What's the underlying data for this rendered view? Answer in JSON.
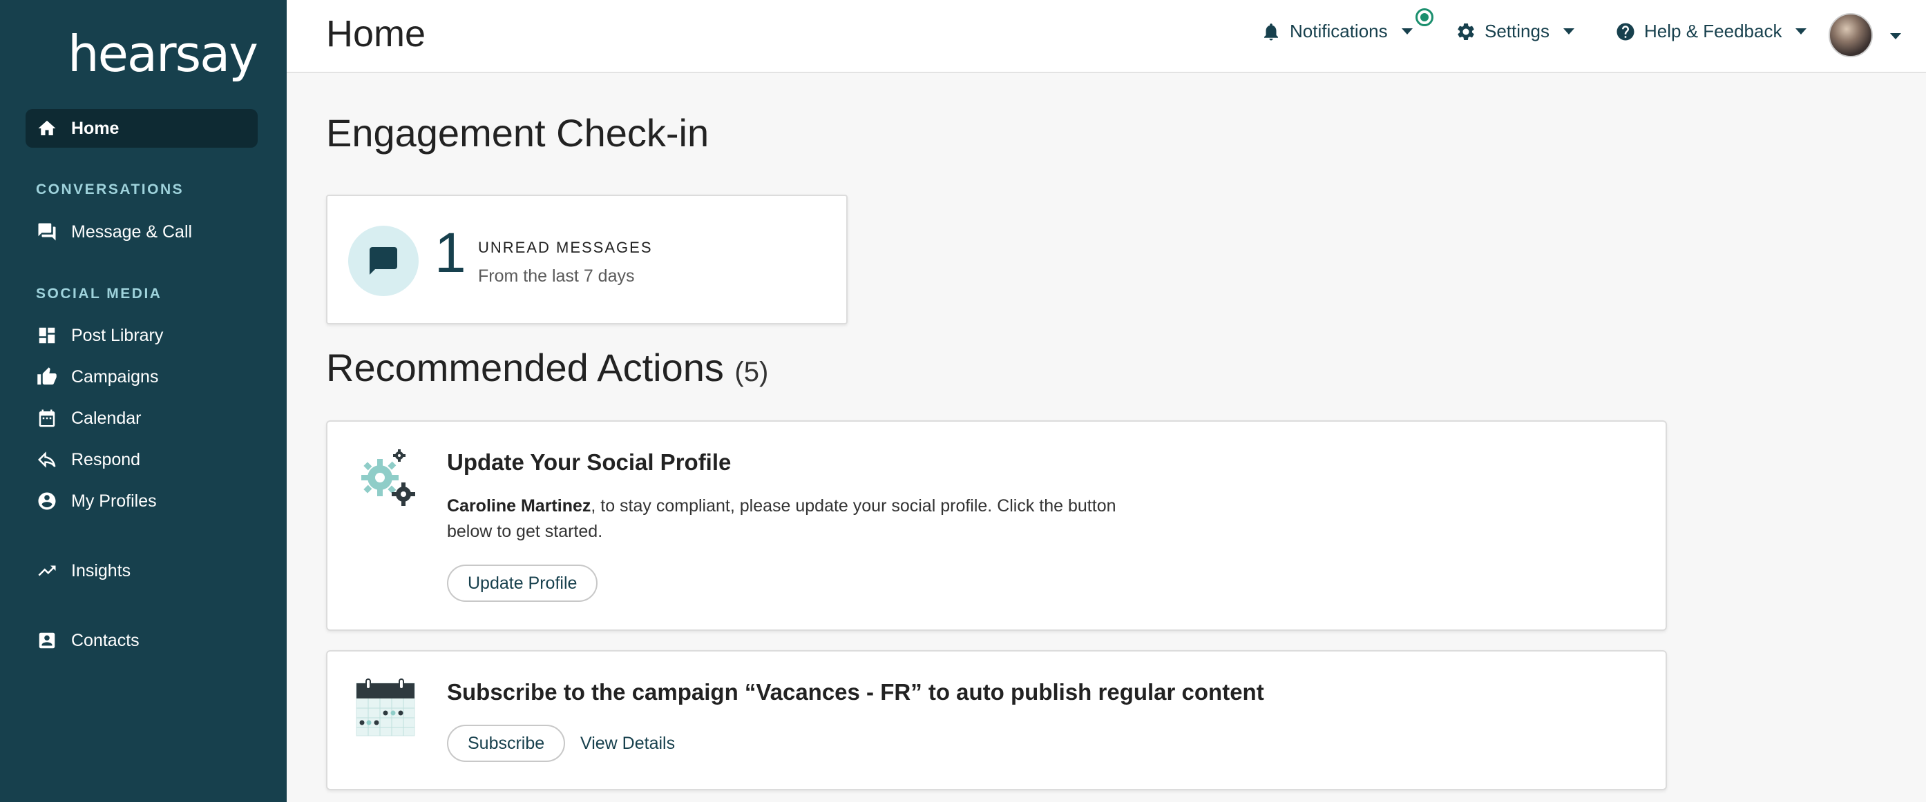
{
  "brand": {
    "logo_text": "hearsay"
  },
  "sidebar": {
    "home": "Home",
    "section_conversations": "CONVERSATIONS",
    "message_call": "Message & Call",
    "section_social": "SOCIAL MEDIA",
    "post_library": "Post Library",
    "campaigns": "Campaigns",
    "calendar": "Calendar",
    "respond": "Respond",
    "my_profiles": "My Profiles",
    "insights": "Insights",
    "contacts": "Contacts"
  },
  "header": {
    "title": "Home",
    "notifications": "Notifications",
    "settings": "Settings",
    "help": "Help & Feedback"
  },
  "engagement": {
    "heading": "Engagement Check-in",
    "unread_count": "1",
    "unread_label": "UNREAD MESSAGES",
    "unread_sub": "From the last 7 days"
  },
  "recommended": {
    "heading": "Recommended Actions",
    "count": "(5)",
    "cards": [
      {
        "title": "Update Your Social Profile",
        "name": "Caroline Martinez",
        "body": ", to stay compliant, please update your social profile. Click the button below to get started.",
        "button": "Update Profile"
      },
      {
        "title": "Subscribe to the campaign “Vacances - FR” to auto publish regular content",
        "button": "Subscribe",
        "link": "View Details"
      }
    ]
  },
  "colors": {
    "sidebar_bg": "#17404d",
    "active_bg": "#0e2a33",
    "accent": "#17404d",
    "notif_dot": "#1b8f6e"
  }
}
